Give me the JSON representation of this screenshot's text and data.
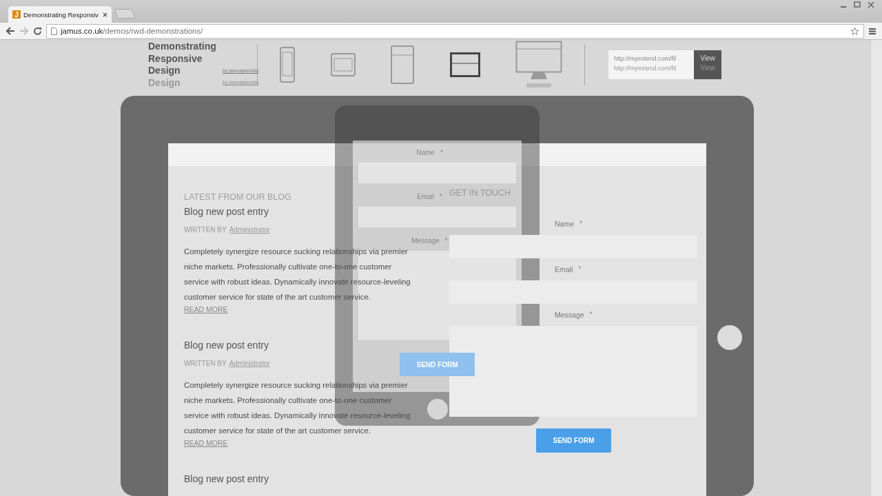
{
  "browser": {
    "tab": {
      "title": "Demonstrating Responsiv",
      "favicon": "J"
    },
    "address": {
      "domain": "jamus.co.uk",
      "path": "/demos/rwd-demonstrations/"
    }
  },
  "header": {
    "title": "Demonstrating Responsive Design",
    "byline": "by jamusjamoids",
    "ghost_title": "Design",
    "ghost_byline": "by jamusjamoids",
    "devices": [
      {
        "kind": "phone",
        "selected": false
      },
      {
        "kind": "phone-landscape",
        "selected": false
      },
      {
        "kind": "tablet",
        "selected": false
      },
      {
        "kind": "tablet-landscape",
        "selected": true
      },
      {
        "kind": "desktop",
        "selected": false
      }
    ],
    "url_field": {
      "value": "http://myextend.com/fil",
      "ghost_value": "http://myextend.com/fil"
    },
    "view_button": "View",
    "ghost_view_button": "View"
  },
  "blog": {
    "heading": "LATEST FROM OUR BLOG",
    "posts": [
      {
        "title": "Blog new post entry",
        "written_by": "WRITTEN BY",
        "author": "Administrator",
        "body": "Completely synergize resource sucking relationships via premier niche markets. Professionally cultivate one-to-one customer service with robust ideas. Dynamically innovate resource-leveling customer service for state of the art customer service.",
        "read_more": "READ MORE"
      },
      {
        "title": "Blog new post entry",
        "written_by": "WRITTEN BY",
        "author": "Administrator",
        "body": "Completely synergize resource sucking relationships via premier niche markets. Professionally cultivate one-to-one customer service with robust ideas. Dynamically innovate resource-leveling customer service for state of the art customer service.",
        "read_more": "READ MORE"
      },
      {
        "title": "Blog new post entry"
      }
    ]
  },
  "contact": {
    "heading": "GET IN TOUCH",
    "fields": [
      {
        "kind": "input",
        "label": "Name",
        "mark": "*"
      },
      {
        "kind": "input",
        "label": "Email",
        "mark": "*"
      },
      {
        "kind": "textarea",
        "label": "Message",
        "mark": "*"
      }
    ],
    "button": "SEND FORM"
  },
  "phone_overlay": {
    "fields": [
      {
        "kind": "input",
        "label": "Name",
        "mark": "*"
      },
      {
        "kind": "input",
        "label": "Email",
        "mark": "*"
      },
      {
        "kind": "textarea",
        "label": "Message",
        "mark": "*"
      }
    ],
    "button": "SEND FORM"
  }
}
